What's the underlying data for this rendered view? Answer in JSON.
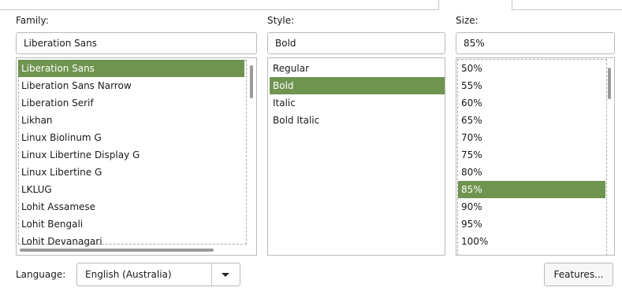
{
  "family": {
    "label": "Family:",
    "value": "Liberation Sans",
    "items": [
      "Liberation Sans",
      "Liberation Sans Narrow",
      "Liberation Serif",
      "Likhan",
      "Linux Biolinum G",
      "Linux Libertine Display G",
      "Linux Libertine G",
      "LKLUG",
      "Lohit Assamese",
      "Lohit Bengali",
      "Lohit Devanagari"
    ],
    "selected_index": 0
  },
  "style": {
    "label": "Style:",
    "value": "Bold",
    "items": [
      "Regular",
      "Bold",
      "Italic",
      "Bold Italic"
    ],
    "selected_index": 1
  },
  "size": {
    "label": "Size:",
    "value": "85%",
    "items": [
      "50%",
      "55%",
      "60%",
      "65%",
      "70%",
      "75%",
      "80%",
      "85%",
      "90%",
      "95%",
      "100%"
    ],
    "selected_index": 7
  },
  "language": {
    "label": "Language:",
    "value": "English (Australia)"
  },
  "features_button": "Features...",
  "colors": {
    "selection": "#6f9450",
    "border": "#b9b9b9"
  }
}
